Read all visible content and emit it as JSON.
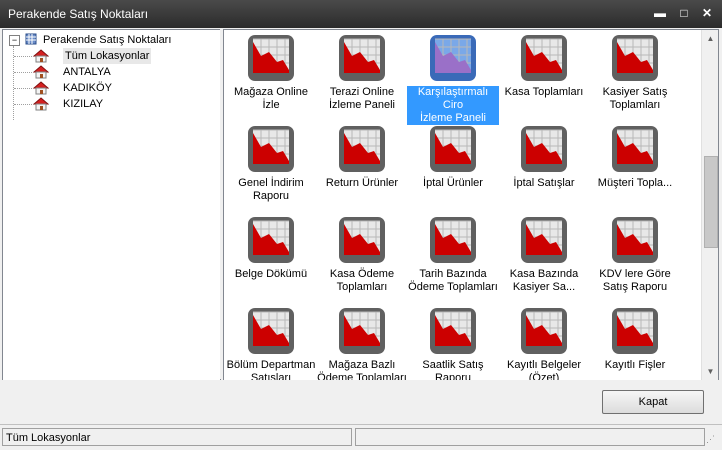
{
  "window": {
    "title": "Perakende Satış Noktaları",
    "min": "▬",
    "max": "□",
    "close": "✕"
  },
  "tree": {
    "root": "Perakende Satış Noktaları",
    "items": [
      {
        "label": "Tüm Lokasyonlar"
      },
      {
        "label": "ANTALYA"
      },
      {
        "label": "KADIKÖY"
      },
      {
        "label": "KIZILAY"
      }
    ]
  },
  "reports": [
    {
      "line1": "Mağaza Online",
      "line2": "İzle"
    },
    {
      "line1": "Terazi Online",
      "line2": "İzleme Paneli"
    },
    {
      "line1": "Karşılaştırmalı Ciro",
      "line2": "İzleme Paneli"
    },
    {
      "line1": "Kasa Toplamları",
      "line2": ""
    },
    {
      "line1": "Kasiyer Satış",
      "line2": "Toplamları"
    },
    {
      "line1": "Genel İndirim",
      "line2": "Raporu"
    },
    {
      "line1": "Return Ürünler",
      "line2": ""
    },
    {
      "line1": "İptal Ürünler",
      "line2": ""
    },
    {
      "line1": "İptal Satışlar",
      "line2": ""
    },
    {
      "line1": "Müşteri Topla...",
      "line2": ""
    },
    {
      "line1": "Belge Dökümü",
      "line2": ""
    },
    {
      "line1": "Kasa Ödeme",
      "line2": "Toplamları"
    },
    {
      "line1": "Tarih Bazında",
      "line2": "Ödeme Toplamları"
    },
    {
      "line1": "Kasa Bazında",
      "line2": "Kasiyer Sa..."
    },
    {
      "line1": "KDV lere Göre",
      "line2": "Satış Raporu"
    },
    {
      "line1": "Bölüm Departman",
      "line2": "Satışları"
    },
    {
      "line1": "Mağaza Bazlı",
      "line2": "Ödeme Toplamları"
    },
    {
      "line1": "Saatlik Satış",
      "line2": "Raporu"
    },
    {
      "line1": "Kayıtlı Belgeler",
      "line2": "(Özet)"
    },
    {
      "line1": "Kayıtlı Fişler",
      "line2": ""
    }
  ],
  "buttons": {
    "close_label": "Kapat"
  },
  "status": {
    "left": "Tüm Lokasyonlar",
    "right": ""
  },
  "colors": {
    "selected": "#3399ff",
    "icon_red": "#cc0000",
    "icon_frame": "#606060"
  }
}
